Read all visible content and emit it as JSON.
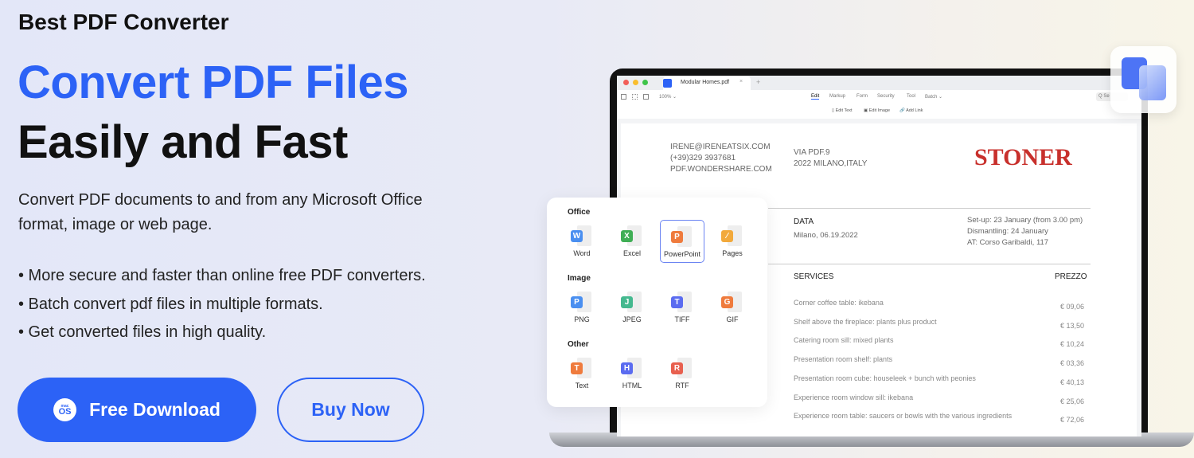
{
  "brand": "Best PDF Converter",
  "headline": {
    "line1": "Convert PDF Files",
    "line2": "Easily and Fast"
  },
  "description": "Convert PDF documents to and from any Microsoft Office format, image or web page.",
  "bullets": [
    "• More secure and faster than online free PDF converters.",
    "• Batch convert pdf files in multiple formats.",
    "• Get converted files in high quality."
  ],
  "buttons": {
    "download": "Free Download",
    "download_os_top": "mac",
    "download_os": "OS",
    "buy": "Buy Now"
  },
  "colors": {
    "accent": "#2c62f6",
    "stoner": "#c8302c"
  },
  "app": {
    "tab_title": "Modular Homes.pdf",
    "zoom": "100% ⌄",
    "menu": [
      "Edit",
      "Markup",
      "Form",
      "Security",
      "Tool",
      "Batch ⌄"
    ],
    "tools": [
      "Edit Text",
      "Edit Image",
      "Add Link"
    ],
    "search_placeholder": "Q Se"
  },
  "doc": {
    "contact": [
      "IRENE@IRENEATSIX.COM",
      "(+39)329 3937681",
      "PDF.WONDERSHARE.COM"
    ],
    "address": [
      "VIA PDF.9",
      "2022 MILANO,ITALY"
    ],
    "logo": "STONER",
    "data_label": "DATA",
    "data_value": "Milano, 06.19.2022",
    "schedule": [
      "Set-up: 23 January (from 3.00 pm)",
      "Dismantling: 24 January",
      "AT: Corso Garibaldi, 117"
    ],
    "services_label": "SERVICES",
    "price_label": "PREZZO",
    "services": [
      {
        "name": "Corner coffee table: ikebana",
        "price": "€ 09,06"
      },
      {
        "name": "Shelf above the fireplace: plants plus product",
        "price": "€ 13,50"
      },
      {
        "name": "Catering room sill: mixed plants",
        "price": "€ 10,24"
      },
      {
        "name": "Presentation room shelf: plants",
        "price": "€ 03,36"
      },
      {
        "name": "Presentation room cube: houseleek + bunch with peonies",
        "price": "€ 40,13"
      },
      {
        "name": "Experience room window sill: ikebana",
        "price": "€ 25,06"
      },
      {
        "name": "Experience room table: saucers or bowls with the various ingredients",
        "price": "€ 72,06"
      }
    ]
  },
  "formats": [
    {
      "section": "Office",
      "items": [
        {
          "label": "Word",
          "letter": "W",
          "color": "#4a8ff0"
        },
        {
          "label": "Excel",
          "letter": "X",
          "color": "#3fae55"
        },
        {
          "label": "PowerPoint",
          "letter": "P",
          "color": "#ef7b3d",
          "selected": true
        },
        {
          "label": "Pages",
          "letter": "∕",
          "color": "#f2a93b"
        }
      ]
    },
    {
      "section": "Image",
      "items": [
        {
          "label": "PNG",
          "letter": "P",
          "color": "#4a8ff0"
        },
        {
          "label": "JPEG",
          "letter": "J",
          "color": "#45b98f"
        },
        {
          "label": "TIFF",
          "letter": "T",
          "color": "#5b6cf0"
        },
        {
          "label": "GIF",
          "letter": "G",
          "color": "#ef7b3d"
        }
      ]
    },
    {
      "section": "Other",
      "items": [
        {
          "label": "Text",
          "letter": "T",
          "color": "#ef7b3d"
        },
        {
          "label": "HTML",
          "letter": "H",
          "color": "#5b6cf0"
        },
        {
          "label": "RTF",
          "letter": "R",
          "color": "#e8604f"
        }
      ]
    }
  ]
}
